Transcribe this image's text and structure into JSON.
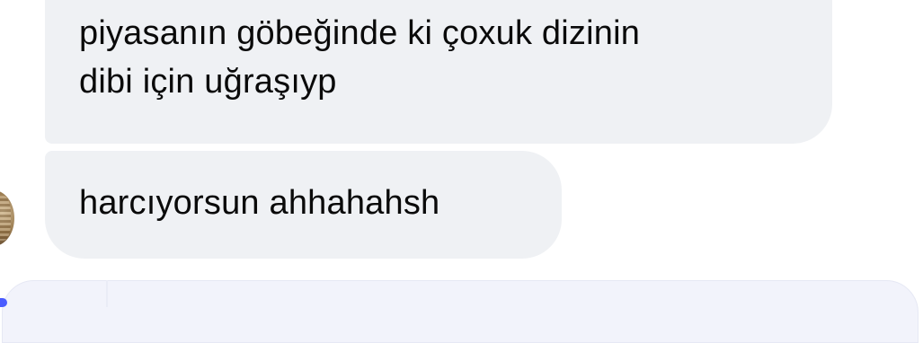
{
  "messages": [
    {
      "lines": [
        "piyasanın göbeğinde ki çoxuk dizinin",
        "dibi için uğraşıyp"
      ]
    },
    {
      "lines": [
        "harcıyorsun ahhahahsh"
      ]
    }
  ],
  "colors": {
    "bubble_background": "#eff1f4",
    "text": "#0a0a0a",
    "composer_background": "#f2f3fb",
    "accent": "#4a5cff"
  },
  "icons": {
    "sender_avatar": "avatar"
  }
}
